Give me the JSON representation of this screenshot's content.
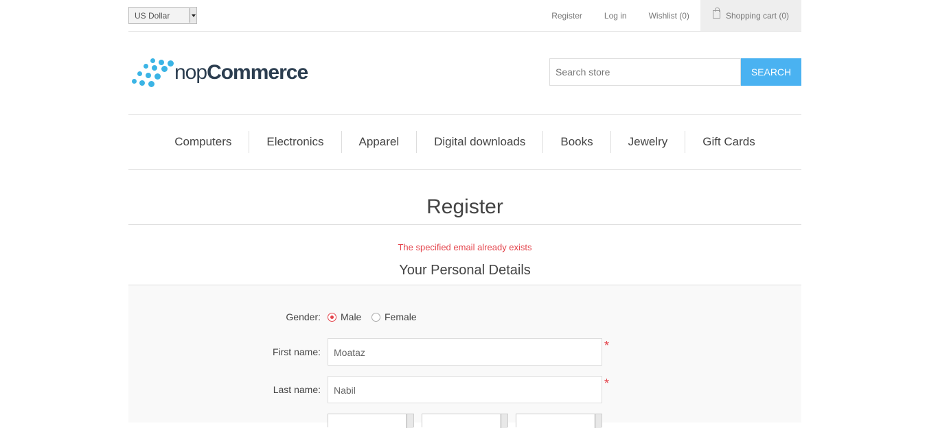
{
  "header": {
    "currency": "US Dollar",
    "register": "Register",
    "login": "Log in",
    "wishlist": "Wishlist (0)",
    "cart": "Shopping cart (0)"
  },
  "logo": {
    "prefix": "nop",
    "brand": "Commerce"
  },
  "search": {
    "placeholder": "Search store",
    "button": "SEARCH"
  },
  "nav": [
    "Computers",
    "Electronics",
    "Apparel",
    "Digital downloads",
    "Books",
    "Jewelry",
    "Gift Cards"
  ],
  "page": {
    "title": "Register",
    "error": "The specified email already exists",
    "section": "Your Personal Details"
  },
  "form": {
    "gender_label": "Gender:",
    "male": "Male",
    "female": "Female",
    "first_name_label": "First name:",
    "first_name_value": "Moataz",
    "last_name_label": "Last name:",
    "last_name_value": "Nabil",
    "required_mark": "*"
  },
  "colors": {
    "accent": "#4ab2f1",
    "error": "#e4434b",
    "logo": "#3bb4e5"
  }
}
